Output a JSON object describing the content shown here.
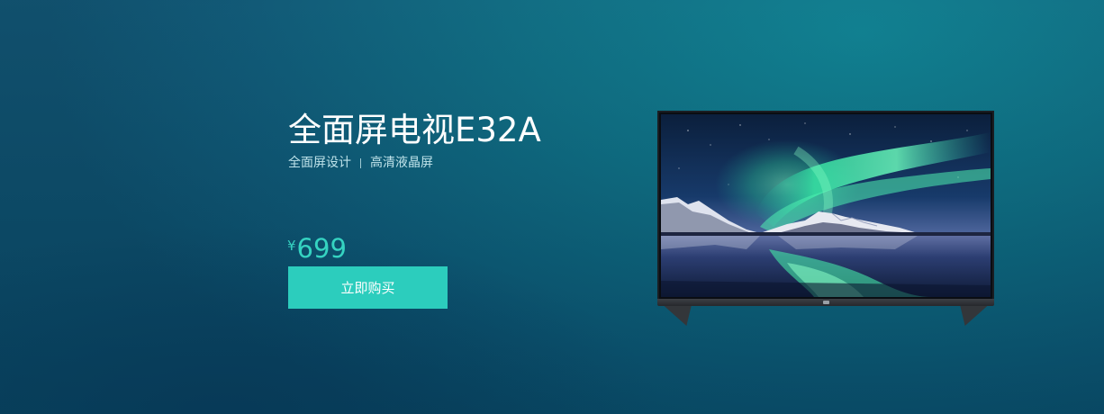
{
  "product": {
    "title": "全面屏电视E32A",
    "features": [
      "全面屏设计",
      "高清液晶屏"
    ],
    "price": {
      "currency": "¥",
      "amount": "699"
    },
    "buy_label": "立即购买"
  },
  "colors": {
    "background": "#0a6a80",
    "accent": "#2ccdbd",
    "price": "#35d3c1"
  },
  "images": {
    "tv": "tv-aurora-landscape"
  }
}
